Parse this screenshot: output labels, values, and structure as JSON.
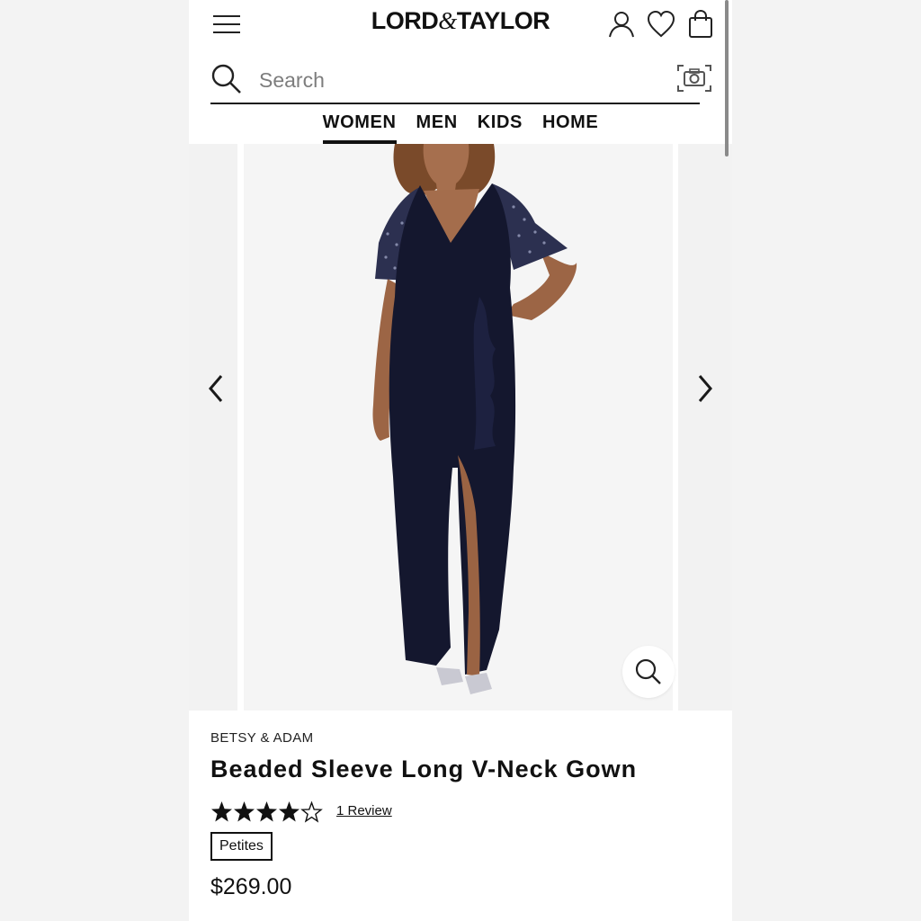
{
  "header": {
    "logo_left": "LORD",
    "logo_amp": "&",
    "logo_right": "TAYLOR",
    "icons": [
      "menu-icon",
      "account-icon",
      "wishlist-heart-icon",
      "shopping-bag-icon"
    ]
  },
  "search": {
    "placeholder": "Search",
    "value": "",
    "icons": [
      "search-icon",
      "camera-icon"
    ]
  },
  "nav": {
    "items": [
      {
        "label": "WOMEN",
        "active": true
      },
      {
        "label": "MEN",
        "active": false
      },
      {
        "label": "KIDS",
        "active": false
      },
      {
        "label": "HOME",
        "active": false
      }
    ]
  },
  "carousel": {
    "prev_icon": "chevron-left-icon",
    "next_icon": "chevron-right-icon",
    "zoom_icon": "zoom-icon"
  },
  "product": {
    "brand": "BETSY & ADAM",
    "title": "Beaded Sleeve Long V-Neck Gown",
    "rating": 4,
    "rating_max": 5,
    "review_link": "1 Review",
    "badge": "Petites",
    "price": "$269.00"
  },
  "colors": {
    "gown": "#14172e",
    "skin": "#a06a4a",
    "hair": "#7a4a2a",
    "text": "#111111"
  }
}
